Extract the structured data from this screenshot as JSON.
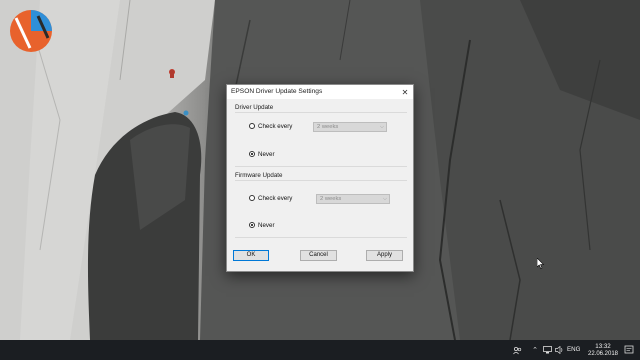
{
  "dialog": {
    "title": "EPSON Driver Update Settings",
    "close_glyph": "✕",
    "driver_update": {
      "label": "Driver Update",
      "check_every_label": "Check every",
      "interval_value": "2 weeks",
      "never_label": "Never",
      "selected": "never"
    },
    "firmware_update": {
      "label": "Firmware Update",
      "check_every_label": "Check every",
      "interval_value": "2 weeks",
      "never_label": "Never",
      "selected": "never"
    },
    "buttons": {
      "ok": "OK",
      "cancel": "Cancel",
      "apply": "Apply"
    }
  },
  "taskbar": {
    "language": "ENG",
    "time": "13:32",
    "date": "22.06.2018",
    "tray_icons": [
      "people-icon",
      "chevron-up-icon",
      "network-icon",
      "speaker-icon"
    ]
  },
  "colors": {
    "dialog_bg": "#f0f0f0",
    "taskbar_bg": "#1b1e22",
    "accent": "#0078d7"
  }
}
